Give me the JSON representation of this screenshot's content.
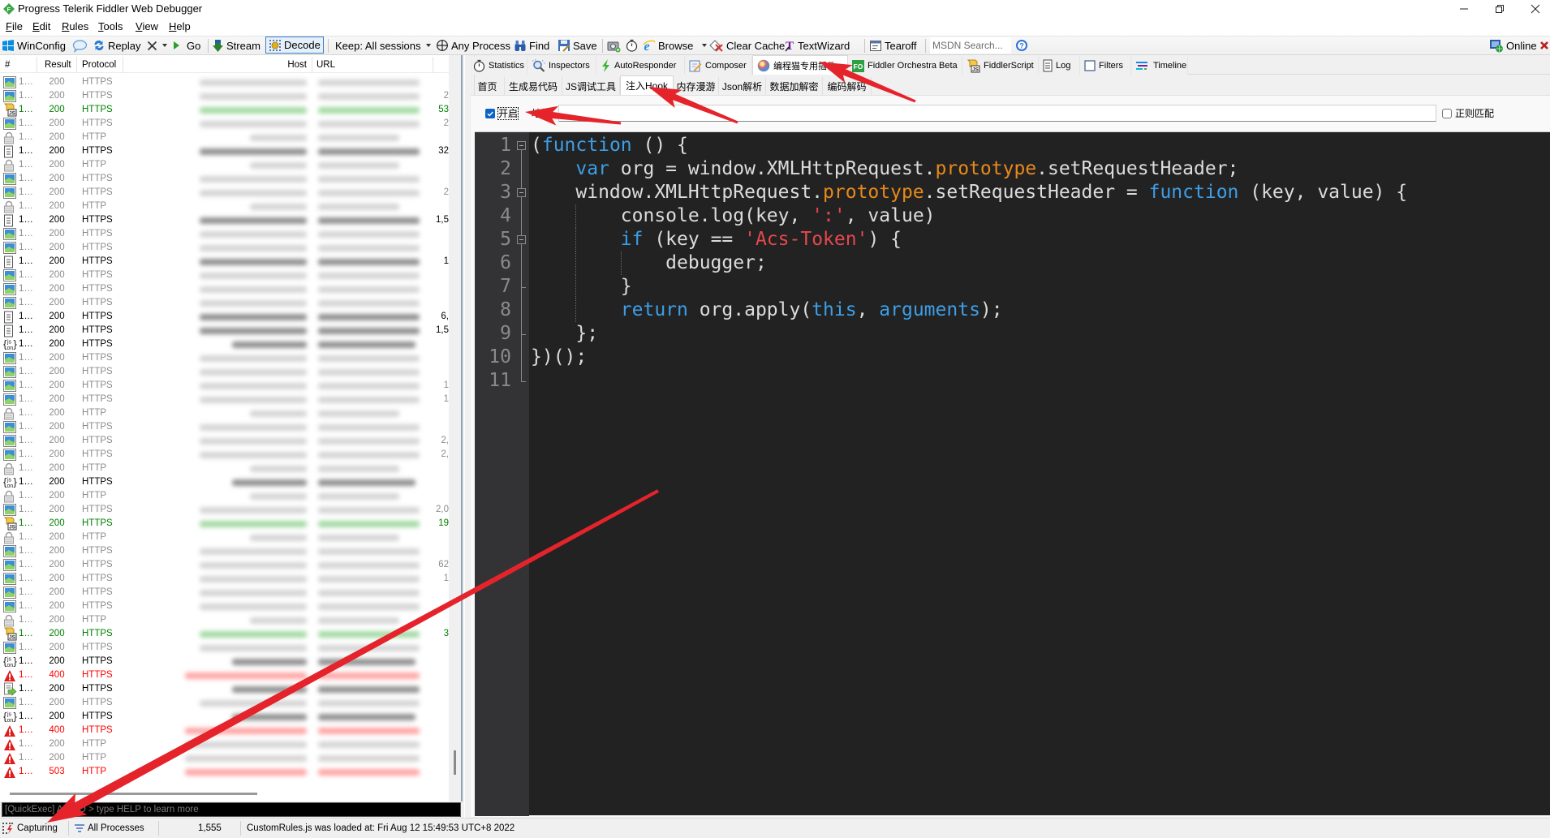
{
  "window": {
    "title": "Progress Telerik Fiddler Web Debugger"
  },
  "menu": {
    "items": [
      "File",
      "Edit",
      "Rules",
      "Tools",
      "View",
      "Help"
    ]
  },
  "toolbar": {
    "winconfig": "WinConfig",
    "replay": "Replay",
    "go": "Go",
    "stream": "Stream",
    "decode": "Decode",
    "decode_pressed": true,
    "keep": "Keep: All sessions",
    "any_process": "Any Process",
    "find": "Find",
    "save": "Save",
    "browse": "Browse",
    "clear_cache": "Clear Cache",
    "text_wizard": "TextWizard",
    "tearoff": "Tearoff",
    "msdn_search_placeholder": "MSDN Search...",
    "online": "Online"
  },
  "theme": {
    "row_dim": "#8c8c8c",
    "row_normal": "#000000",
    "row_script": "#008000",
    "row_error": "#ff0000",
    "editor_keyword": "#3d9ee6",
    "editor_property": "#e8891c",
    "editor_string": "#e5484d",
    "editor_text": "#dcdcdc",
    "annotation": "#e5232b",
    "checkbox_accent": "#0a64c8"
  },
  "sessions": {
    "columns": {
      "id": "#",
      "result": "Result",
      "protocol": "Protocol",
      "host": "Host",
      "url": "URL"
    },
    "host_url_redacted": true,
    "rows": [
      {
        "id": "1…",
        "icon": "image-icon",
        "result": "200",
        "protocol": "HTTPS",
        "body": "",
        "style": "dim"
      },
      {
        "id": "1…",
        "icon": "image-icon",
        "result": "200",
        "protocol": "HTTPS",
        "body": "2",
        "style": "dim"
      },
      {
        "id": "1…",
        "icon": "script-icon",
        "result": "200",
        "protocol": "HTTPS",
        "body": "53",
        "style": "script"
      },
      {
        "id": "1…",
        "icon": "image-icon",
        "result": "200",
        "protocol": "HTTPS",
        "body": "2",
        "style": "dim"
      },
      {
        "id": "1…",
        "icon": "lock-icon",
        "result": "200",
        "protocol": "HTTP",
        "body": "",
        "style": "dim"
      },
      {
        "id": "1…",
        "icon": "document-icon",
        "result": "200",
        "protocol": "HTTPS",
        "body": "32",
        "style": "normal"
      },
      {
        "id": "1…",
        "icon": "lock-icon",
        "result": "200",
        "protocol": "HTTP",
        "body": "",
        "style": "dim"
      },
      {
        "id": "1…",
        "icon": "image-icon",
        "result": "200",
        "protocol": "HTTPS",
        "body": "",
        "style": "dim"
      },
      {
        "id": "1…",
        "icon": "image-icon",
        "result": "200",
        "protocol": "HTTPS",
        "body": "2",
        "style": "dim"
      },
      {
        "id": "1…",
        "icon": "lock-icon",
        "result": "200",
        "protocol": "HTTP",
        "body": "",
        "style": "dim"
      },
      {
        "id": "1…",
        "icon": "document-icon",
        "result": "200",
        "protocol": "HTTPS",
        "body": "1,5",
        "style": "normal"
      },
      {
        "id": "1…",
        "icon": "image-icon",
        "result": "200",
        "protocol": "HTTPS",
        "body": "",
        "style": "dim"
      },
      {
        "id": "1…",
        "icon": "image-icon",
        "result": "200",
        "protocol": "HTTPS",
        "body": "",
        "style": "dim"
      },
      {
        "id": "1…",
        "icon": "document-icon",
        "result": "200",
        "protocol": "HTTPS",
        "body": "1",
        "style": "normal"
      },
      {
        "id": "1…",
        "icon": "image-icon",
        "result": "200",
        "protocol": "HTTPS",
        "body": "",
        "style": "dim"
      },
      {
        "id": "1…",
        "icon": "image-icon",
        "result": "200",
        "protocol": "HTTPS",
        "body": "",
        "style": "dim"
      },
      {
        "id": "1…",
        "icon": "image-icon",
        "result": "200",
        "protocol": "HTTPS",
        "body": "",
        "style": "dim"
      },
      {
        "id": "1…",
        "icon": "document-icon",
        "result": "200",
        "protocol": "HTTPS",
        "body": "6,",
        "style": "normal"
      },
      {
        "id": "1…",
        "icon": "document-icon",
        "result": "200",
        "protocol": "HTTPS",
        "body": "1,5",
        "style": "normal"
      },
      {
        "id": "1…",
        "icon": "json-icon",
        "result": "200",
        "protocol": "HTTPS",
        "body": "",
        "style": "normal"
      },
      {
        "id": "1…",
        "icon": "image-icon",
        "result": "200",
        "protocol": "HTTPS",
        "body": "",
        "style": "dim"
      },
      {
        "id": "1…",
        "icon": "image-icon",
        "result": "200",
        "protocol": "HTTPS",
        "body": "",
        "style": "dim"
      },
      {
        "id": "1…",
        "icon": "image-icon",
        "result": "200",
        "protocol": "HTTPS",
        "body": "1",
        "style": "dim"
      },
      {
        "id": "1…",
        "icon": "image-icon",
        "result": "200",
        "protocol": "HTTPS",
        "body": "1",
        "style": "dim"
      },
      {
        "id": "1…",
        "icon": "lock-icon",
        "result": "200",
        "protocol": "HTTP",
        "body": "",
        "style": "dim"
      },
      {
        "id": "1…",
        "icon": "image-icon",
        "result": "200",
        "protocol": "HTTPS",
        "body": "",
        "style": "dim"
      },
      {
        "id": "1…",
        "icon": "image-icon",
        "result": "200",
        "protocol": "HTTPS",
        "body": "2,",
        "style": "dim"
      },
      {
        "id": "1…",
        "icon": "image-icon",
        "result": "200",
        "protocol": "HTTPS",
        "body": "2,",
        "style": "dim"
      },
      {
        "id": "1…",
        "icon": "lock-icon",
        "result": "200",
        "protocol": "HTTP",
        "body": "",
        "style": "dim"
      },
      {
        "id": "1…",
        "icon": "json-icon",
        "result": "200",
        "protocol": "HTTPS",
        "body": "",
        "style": "normal"
      },
      {
        "id": "1…",
        "icon": "lock-icon",
        "result": "200",
        "protocol": "HTTP",
        "body": "",
        "style": "dim"
      },
      {
        "id": "1…",
        "icon": "image-icon",
        "result": "200",
        "protocol": "HTTPS",
        "body": "2,0",
        "style": "dim"
      },
      {
        "id": "1…",
        "icon": "script-icon",
        "result": "200",
        "protocol": "HTTPS",
        "body": "19",
        "style": "script"
      },
      {
        "id": "1…",
        "icon": "lock-icon",
        "result": "200",
        "protocol": "HTTP",
        "body": "",
        "style": "dim"
      },
      {
        "id": "1…",
        "icon": "image-icon",
        "result": "200",
        "protocol": "HTTPS",
        "body": "",
        "style": "dim"
      },
      {
        "id": "1…",
        "icon": "image-icon",
        "result": "200",
        "protocol": "HTTPS",
        "body": "62",
        "style": "dim"
      },
      {
        "id": "1…",
        "icon": "image-icon",
        "result": "200",
        "protocol": "HTTPS",
        "body": "1",
        "style": "dim"
      },
      {
        "id": "1…",
        "icon": "image-icon",
        "result": "200",
        "protocol": "HTTPS",
        "body": "",
        "style": "dim"
      },
      {
        "id": "1…",
        "icon": "image-icon",
        "result": "200",
        "protocol": "HTTPS",
        "body": "",
        "style": "dim"
      },
      {
        "id": "1…",
        "icon": "lock-icon",
        "result": "200",
        "protocol": "HTTP",
        "body": "",
        "style": "dim"
      },
      {
        "id": "1…",
        "icon": "script-icon",
        "result": "200",
        "protocol": "HTTPS",
        "body": "3",
        "style": "script"
      },
      {
        "id": "1…",
        "icon": "image-icon",
        "result": "200",
        "protocol": "HTTPS",
        "body": "",
        "style": "dim"
      },
      {
        "id": "1…",
        "icon": "json-icon",
        "result": "200",
        "protocol": "HTTPS",
        "body": "",
        "style": "normal"
      },
      {
        "id": "1…",
        "icon": "warning-icon",
        "result": "400",
        "protocol": "HTTPS",
        "body": "",
        "style": "error"
      },
      {
        "id": "1…",
        "icon": "redirect-icon",
        "result": "200",
        "protocol": "HTTPS",
        "body": "",
        "style": "normal"
      },
      {
        "id": "1…",
        "icon": "image-icon",
        "result": "200",
        "protocol": "HTTPS",
        "body": "",
        "style": "dim"
      },
      {
        "id": "1…",
        "icon": "json-icon",
        "result": "200",
        "protocol": "HTTPS",
        "body": "",
        "style": "normal"
      },
      {
        "id": "1…",
        "icon": "warning-icon",
        "result": "400",
        "protocol": "HTTPS",
        "body": "",
        "style": "error"
      },
      {
        "id": "1…",
        "icon": "warning-icon",
        "result": "200",
        "protocol": "HTTP",
        "body": "",
        "style": "dim"
      },
      {
        "id": "1…",
        "icon": "warning-icon",
        "result": "200",
        "protocol": "HTTP",
        "body": "",
        "style": "dim"
      },
      {
        "id": "1…",
        "icon": "warning-icon",
        "result": "503",
        "protocol": "HTTP",
        "body": "",
        "style": "error"
      }
    ]
  },
  "quickexec": {
    "placeholder": "[QuickExec] ALT+Q > type HELP to learn more",
    "value": ""
  },
  "tabs": {
    "selected": 4,
    "items": [
      {
        "label": "Statistics",
        "icon": "stopwatch-icon"
      },
      {
        "label": "Inspectors",
        "icon": "inspector-magnifier-icon"
      },
      {
        "label": "AutoResponder",
        "icon": "lightning-icon"
      },
      {
        "label": "Composer",
        "icon": "composer-icon"
      },
      {
        "label": "编程猫专用插件",
        "icon": "plugin-orb-icon"
      },
      {
        "label": "Fiddler Orchestra Beta",
        "icon": "fo-logo-icon"
      },
      {
        "label": "FiddlerScript",
        "icon": "script-scroll-icon"
      },
      {
        "label": "Log",
        "icon": "log-icon"
      },
      {
        "label": "Filters",
        "icon": "filters-checkbox-icon"
      },
      {
        "label": "Timeline",
        "icon": "timeline-icon"
      }
    ]
  },
  "subtabs": {
    "selected": 3,
    "items": [
      "首页",
      "生成易代码",
      "JS调试工具",
      "注入Hook",
      "内存漫游",
      "Json解析",
      "数据加解密",
      "编码解码"
    ]
  },
  "hook": {
    "enable_label": "开启",
    "enabled": true,
    "url_label": "地址:",
    "url_value": "",
    "regex_label": "正则匹配",
    "regex_checked": false
  },
  "editor": {
    "line_numbers": [
      "1",
      "2",
      "3",
      "4",
      "5",
      "6",
      "7",
      "8",
      "9",
      "10",
      "11"
    ],
    "fold_lines": [
      1,
      3,
      5
    ],
    "fold_end_lines": [
      7,
      9,
      11
    ],
    "lines": [
      [
        {
          "type": "plain",
          "text": "("
        },
        {
          "type": "keyword",
          "text": "function"
        },
        {
          "type": "plain",
          "text": " () {"
        }
      ],
      [
        {
          "type": "plain",
          "text": "    "
        },
        {
          "type": "keyword",
          "text": "var"
        },
        {
          "type": "plain",
          "text": " org = window.XMLHttpRequest."
        },
        {
          "type": "property",
          "text": "prototype"
        },
        {
          "type": "plain",
          "text": ".setRequestHeader;"
        }
      ],
      [
        {
          "type": "plain",
          "text": "    window.XMLHttpRequest."
        },
        {
          "type": "property",
          "text": "prototype"
        },
        {
          "type": "plain",
          "text": ".setRequestHeader = "
        },
        {
          "type": "keyword",
          "text": "function"
        },
        {
          "type": "plain",
          "text": " (key, value) {"
        }
      ],
      [
        {
          "type": "plain",
          "text": "        console.log(key, "
        },
        {
          "type": "string",
          "text": "':'"
        },
        {
          "type": "plain",
          "text": ", value)"
        }
      ],
      [
        {
          "type": "plain",
          "text": "        "
        },
        {
          "type": "keyword",
          "text": "if"
        },
        {
          "type": "plain",
          "text": " (key == "
        },
        {
          "type": "string",
          "text": "'Acs-Token'"
        },
        {
          "type": "plain",
          "text": ") {"
        }
      ],
      [
        {
          "type": "plain",
          "text": "            debugger;"
        }
      ],
      [
        {
          "type": "plain",
          "text": "        }"
        }
      ],
      [
        {
          "type": "plain",
          "text": "        "
        },
        {
          "type": "keyword",
          "text": "return"
        },
        {
          "type": "plain",
          "text": " org.apply("
        },
        {
          "type": "keyword",
          "text": "this"
        },
        {
          "type": "plain",
          "text": ", "
        },
        {
          "type": "keyword",
          "text": "arguments"
        },
        {
          "type": "plain",
          "text": ");"
        }
      ],
      [
        {
          "type": "plain",
          "text": "    };"
        }
      ],
      [
        {
          "type": "plain",
          "text": "})();"
        }
      ],
      []
    ]
  },
  "statusbar": {
    "capturing": "Capturing",
    "process_filter": "All Processes",
    "session_count": "1,555",
    "message": "CustomRules.js was loaded at: Fri Aug 12 15:49:53 UTC+8 2022"
  }
}
